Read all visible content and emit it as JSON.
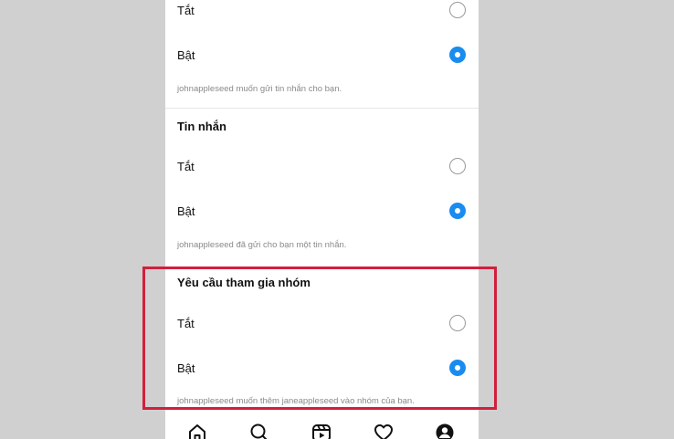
{
  "sections": [
    {
      "title": "",
      "options": [
        {
          "label": "Tắt",
          "selected": false
        },
        {
          "label": "Bật",
          "selected": true
        }
      ],
      "hint": "johnappleseed muốn gửi tin nhắn cho bạn."
    },
    {
      "title": "Tin nhắn",
      "options": [
        {
          "label": "Tắt",
          "selected": false
        },
        {
          "label": "Bật",
          "selected": true
        }
      ],
      "hint": "johnappleseed đã gửi cho bạn một tin nhắn."
    },
    {
      "title": "Yêu cầu tham gia nhóm",
      "options": [
        {
          "label": "Tắt",
          "selected": false
        },
        {
          "label": "Bật",
          "selected": true
        }
      ],
      "hint": "johnappleseed muốn thêm janeappleseed vào nhóm của bạn."
    }
  ],
  "tabbar": {
    "items": [
      "home-icon",
      "search-icon",
      "reels-icon",
      "heart-icon",
      "profile-icon"
    ]
  },
  "colors": {
    "accent": "#1a8cf0",
    "highlight_border": "#d1203c"
  }
}
